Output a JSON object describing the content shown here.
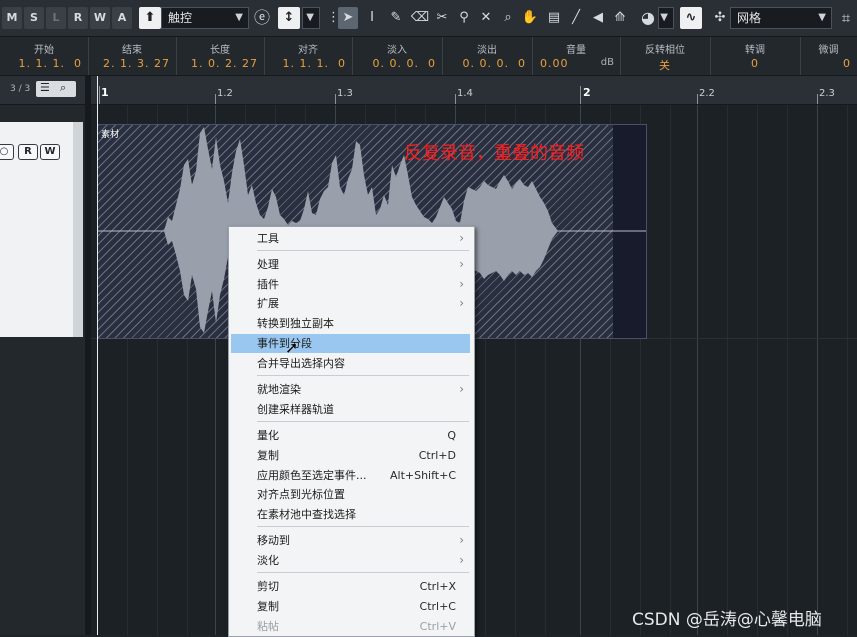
{
  "toolbar": {
    "modes": [
      "M",
      "S",
      "L",
      "R",
      "W",
      "A"
    ],
    "automation_mode": "触控",
    "snap_type": "网格",
    "tools": [
      "object-selection",
      "range-selection",
      "draw",
      "erase",
      "split",
      "glue",
      "mute",
      "zoom",
      "play",
      "comp",
      "line",
      "mute-tool",
      "warp"
    ]
  },
  "infoline": [
    {
      "label": "开始",
      "value": "1. 1. 1.  0"
    },
    {
      "label": "结束",
      "value": "2. 1. 3. 27"
    },
    {
      "label": "长度",
      "value": "1. 0. 2. 27"
    },
    {
      "label": "对齐",
      "value": "1. 1. 1.  0"
    },
    {
      "label": "淡入",
      "value": "0. 0. 0.  0"
    },
    {
      "label": "淡出",
      "value": "0. 0. 0.  0"
    },
    {
      "label": "音量",
      "value": "0.00",
      "unit": "dB"
    },
    {
      "label": "反转相位",
      "value": "关"
    },
    {
      "label": "转调",
      "value": "0"
    },
    {
      "label": "微调",
      "value": "0"
    }
  ],
  "tracklist": {
    "page": "3 / 3",
    "buttons": [
      "○",
      "R",
      "W"
    ]
  },
  "ruler": {
    "labels": [
      "1",
      "1.2",
      "1.3",
      "1.4",
      "2",
      "2.2",
      "2.3"
    ]
  },
  "event": {
    "name": "素材",
    "annotation": "反复录音，重叠的音频"
  },
  "context_menu": {
    "items": [
      {
        "label": "工具",
        "submenu": true
      },
      {
        "label": "处理",
        "submenu": true
      },
      {
        "label": "插件",
        "submenu": true
      },
      {
        "label": "扩展",
        "submenu": true
      },
      {
        "label": "转换到独立副本"
      },
      {
        "label": "事件到分段",
        "highlighted": true
      },
      {
        "label": "合并导出选择内容"
      },
      {
        "label": "就地渲染",
        "submenu": true
      },
      {
        "label": "创建采样器轨道"
      },
      {
        "label": "量化",
        "shortcut": "Q"
      },
      {
        "label": "复制",
        "shortcut": "Ctrl+D"
      },
      {
        "label": "应用颜色至选定事件...",
        "shortcut": "Alt+Shift+C"
      },
      {
        "label": "对齐点到光标位置"
      },
      {
        "label": "在素材池中查找选择"
      },
      {
        "label": "移动到",
        "submenu": true
      },
      {
        "label": "淡化",
        "submenu": true
      },
      {
        "label": "剪切",
        "shortcut": "Ctrl+X"
      },
      {
        "label": "复制",
        "shortcut": "Ctrl+C"
      },
      {
        "label": "粘帖",
        "shortcut": "Ctrl+V",
        "disabled": true
      }
    ]
  },
  "watermark": "CSDN @岳涛@心馨电脑",
  "colors": {
    "accent_orange": "#e8a040",
    "menu_highlight": "#99c7ef",
    "annotation_red": "#ff1e1e"
  }
}
